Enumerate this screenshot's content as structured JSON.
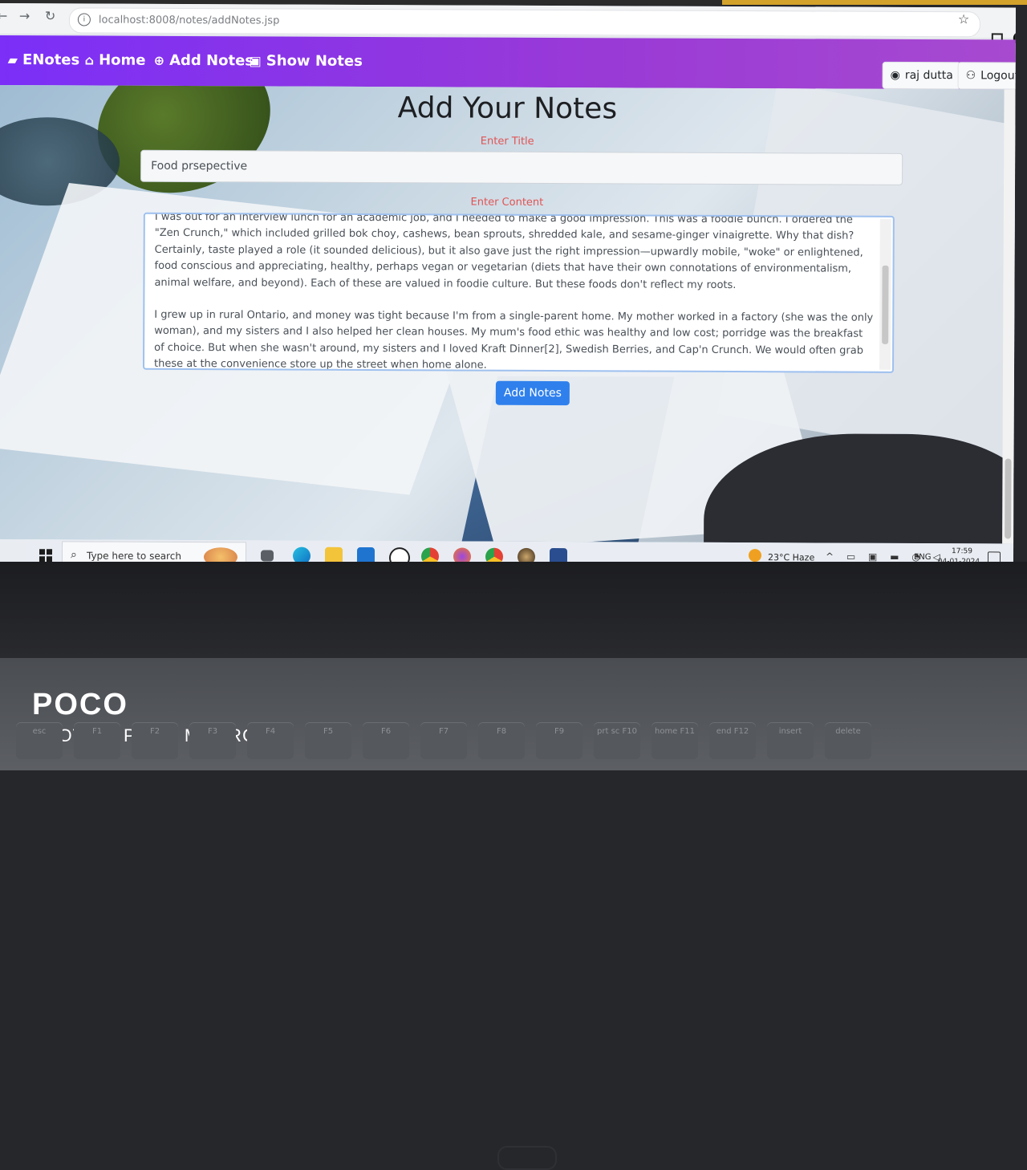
{
  "browser": {
    "url": "localhost:8008/notes/addNotes.jsp"
  },
  "navbar": {
    "brand": "ENotes",
    "links": [
      {
        "label": "Home",
        "icon": "home-icon"
      },
      {
        "label": "Add Notes",
        "icon": "plus-circle-icon"
      },
      {
        "label": "Show Notes",
        "icon": "notes-icon"
      }
    ],
    "user_label": "raj dutta",
    "logout_label": "Logout",
    "gradient_start": "#7b2ff7",
    "gradient_end": "#a74ad0"
  },
  "page": {
    "title": "Add Your Notes",
    "title_label": "Enter Title",
    "title_value": "Food prsepective",
    "content_label": "Enter Content",
    "content_paragraphs": [
      "I was out for an interview lunch for an academic job, and I needed to make a good impression. This was a foodie bunch. I ordered the \"Zen Crunch,\" which included grilled bok choy, cashews, bean sprouts, shredded kale, and sesame-ginger vinaigrette. Why that dish? Certainly, taste played a role (it sounded delicious), but it also gave just the right impression—upwardly mobile, \"woke\" or enlightened, food conscious and appreciating, healthy, perhaps vegan or vegetarian (diets that have their own connotations of environmentalism, animal welfare, and beyond). Each of these are valued in foodie culture. But these foods don't reflect my roots.",
      "I grew up in rural Ontario, and money was tight because I'm from a single-parent home. My mother worked in a factory (she was the only woman), and my sisters and I also helped her clean houses. My mum's food ethic was healthy and low cost; porridge was the breakfast of choice. But when she wasn't around, my sisters and I loved Kraft Dinner[2], Swedish Berries, and Cap'n Crunch. We would often grab these at the convenience store up the street when home alone."
    ],
    "submit_label": "Add Notes",
    "accent_color": "#2f80ed",
    "label_color": "#e05454"
  },
  "taskbar": {
    "search_placeholder": "Type here to search",
    "weather": "23°C  Haze",
    "language": "ENG",
    "time": "17:59",
    "date": "04-01-2024"
  },
  "keyboard": {
    "keys": [
      "esc",
      "F1",
      "F2",
      "F3",
      "F4",
      "F5",
      "F6",
      "F7",
      "F8",
      "F9",
      "prt sc F10",
      "home F11",
      "end F12",
      "insert",
      "delete"
    ]
  },
  "photo_watermark": {
    "brand": "POCO",
    "caption": "SHOT ON POCO M2 PRO"
  }
}
